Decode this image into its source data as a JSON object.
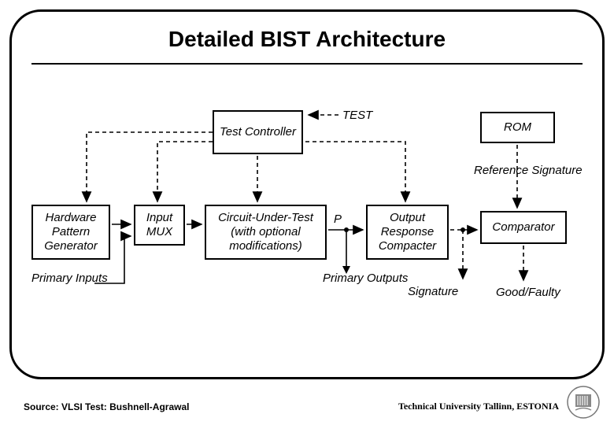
{
  "title": "Detailed BIST Architecture",
  "blocks": {
    "test_controller": "Test\nController",
    "rom": "ROM",
    "hpg": "Hardware\nPattern\nGenerator",
    "imux": "Input\nMUX",
    "cut": "Circuit-Under-Test\n(with optional\nmodifications)",
    "orc": "Output\nResponse\nCompacter",
    "comparator": "Comparator"
  },
  "labels": {
    "test": "TEST",
    "ref_sig": "Reference\nSignature",
    "p": "P",
    "primary_inputs": "Primary\nInputs",
    "primary_outputs": "Primary\nOutputs",
    "signature": "Signature",
    "good_faulty": "Good/Faulty"
  },
  "footer": {
    "left": "Source: VLSI Test: Bushnell-Agrawal",
    "right": "Technical University Tallinn, ESTONIA"
  }
}
